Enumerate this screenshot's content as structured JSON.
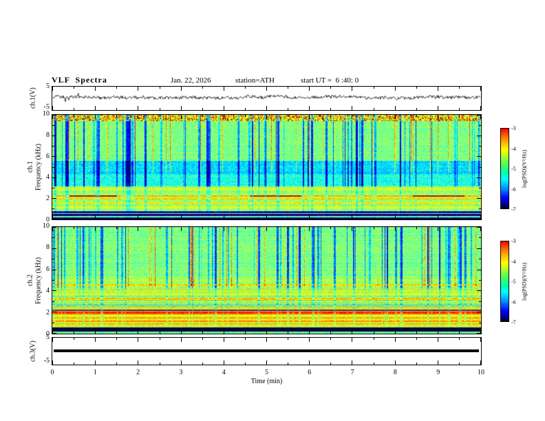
{
  "header": {
    "title": "VLF  Spectra",
    "date": "Jan. 22, 2026",
    "station": "station=ATH",
    "start_ut": "start UT =  6 :40: 0"
  },
  "x_axis": {
    "label": "Time (min)",
    "ticks": [
      "0",
      "1",
      "2",
      "3",
      "4",
      "5",
      "6",
      "7",
      "8",
      "9",
      "10"
    ],
    "range": [
      0,
      10
    ]
  },
  "panels": {
    "ch1_wave": {
      "ylabel": "ch.1(V)",
      "ytick_top": "5",
      "ytick_bottom": "-5",
      "ylim": [
        -5,
        5
      ]
    },
    "ch1_spec": {
      "ylabel_channel": "ch.1",
      "ylabel_axis": "Frequency (kHz)",
      "yticks": [
        "10",
        "8",
        "6",
        "4",
        "2",
        "0"
      ],
      "ylim": [
        0,
        10
      ]
    },
    "ch2_spec": {
      "ylabel_channel": "ch.2",
      "ylabel_axis": "Frequency (kHz)",
      "yticks": [
        "10",
        "8",
        "6",
        "4",
        "2",
        "0"
      ],
      "ylim": [
        0,
        10
      ]
    },
    "ch3_wave": {
      "ylabel": "ch.3(V)",
      "ytick_top": "5",
      "ytick_bottom": "-5",
      "ylim": [
        -5,
        5
      ]
    }
  },
  "colorbar": {
    "label": "log(PSD)(V²/Hz)",
    "ticks": [
      "-3",
      "-4",
      "-5",
      "-6",
      "-7"
    ],
    "range": [
      -7,
      -3
    ],
    "colormap": "jet"
  },
  "chart_data": [
    {
      "type": "line",
      "name": "ch.1 voltage waveform",
      "xlabel": "Time (min)",
      "ylabel": "ch.1(V)",
      "xlim": [
        0,
        10
      ],
      "ylim": [
        -5,
        5
      ],
      "description": "Continuous noisy VLF voltage trace fluctuating around 0 V with amplitude roughly ±1 V and occasional larger impulsive spikes across the full 10 minutes."
    },
    {
      "type": "heatmap",
      "name": "ch.1 spectrogram",
      "xlabel": "Time (min)",
      "ylabel": "Frequency (kHz)",
      "zlabel": "log(PSD)(V²/Hz)",
      "xlim": [
        0,
        10
      ],
      "ylim": [
        0,
        10
      ],
      "zlim": [
        -7,
        -3
      ],
      "colormap": "jet",
      "features": [
        "broadband green/cyan background (~-4.5 to -5 log PSD) above 3 kHz",
        "dense vertical dark-blue sferic streaks spanning 3-10 kHz throughout",
        "darker blue band around 4-5.5 kHz with thin horizontal dark lines",
        "cyan band 1-3 kHz containing persistent horizontal emission lines",
        "strong red/orange line segments near 2.2 kHz around 0.4-1.5, 4.6-5.8 and 8.4-9.6 min",
        "near-black band below ~0.8 kHz with a few green rows",
        "yellow/orange speckle along the very top edge near 10 kHz"
      ]
    },
    {
      "type": "heatmap",
      "name": "ch.2 spectrogram",
      "xlabel": "Time (min)",
      "ylabel": "Frequency (kHz)",
      "zlabel": "log(PSD)(V²/Hz)",
      "xlim": [
        0,
        10
      ],
      "ylim": [
        0,
        10
      ],
      "zlim": [
        -7,
        -3
      ],
      "colormap": "jet",
      "features": [
        "green background above 5 kHz with many vertical dark-blue sferic streaks",
        "strong horizontal striping below 4 kHz in green/yellow/cyan",
        "intense red/orange lines near 1.9-2.3 kHz spanning the full 10 minutes",
        "yellow-green lines near 4.3 and 4.6 kHz",
        "near-black rows below ~0.5 kHz with a green bottom row"
      ]
    },
    {
      "type": "line",
      "name": "ch.3 voltage waveform",
      "xlabel": "Time (min)",
      "ylabel": "ch.3(V)",
      "xlim": [
        0,
        10
      ],
      "ylim": [
        -5,
        5
      ],
      "values_constant": 0,
      "description": "Flat thick black line at 0 V for the entire 10 minutes (no signal on channel 3)."
    }
  ]
}
